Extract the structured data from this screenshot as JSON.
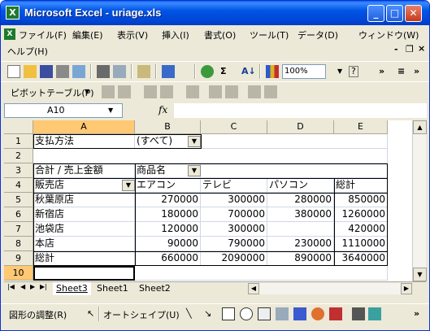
{
  "window": {
    "title": "Microsoft Excel - uriage.xls",
    "app_icon_label": "X"
  },
  "title_buttons": {
    "minimize": "_",
    "maximize": "□",
    "close": "✕"
  },
  "menu": [
    {
      "label": "ファイル(F)"
    },
    {
      "label": "編集(E)"
    },
    {
      "label": "表示(V)"
    },
    {
      "label": "挿入(I)"
    },
    {
      "label": "書式(O)"
    },
    {
      "label": "ツール(T)"
    },
    {
      "label": "データ(D)"
    },
    {
      "label": "ウィンドウ(W)"
    },
    {
      "label": "ヘルプ(H)"
    }
  ],
  "mdi_buttons": {
    "minimize": "-",
    "restore": "❐",
    "close": "×"
  },
  "toolbar": {
    "zoom": "100%",
    "more": "»",
    "pivot_label": "ピボットテーブル(P)",
    "help_icon": "?"
  },
  "formula_bar": {
    "name_box": "A10",
    "fx": "fx",
    "formula": ""
  },
  "columns": [
    "A",
    "B",
    "C",
    "D",
    "E"
  ],
  "rows": [
    "1",
    "2",
    "3",
    "4",
    "5",
    "6",
    "7",
    "8",
    "9",
    "10"
  ],
  "cells": {
    "r1": {
      "a": "支払方法",
      "b": "(すべて)"
    },
    "r3": {
      "a": "合計 / 売上金額",
      "b": "商品名"
    },
    "r4": {
      "a": "販売店",
      "b": "エアコン",
      "c": "テレビ",
      "d": "パソコン",
      "e": "総計"
    },
    "r5": {
      "a": "秋葉原店",
      "b": "270000",
      "c": "300000",
      "d": "280000",
      "e": "850000"
    },
    "r6": {
      "a": "新宿店",
      "b": "180000",
      "c": "700000",
      "d": "380000",
      "e": "1260000"
    },
    "r7": {
      "a": "池袋店",
      "b": "120000",
      "c": "300000",
      "d": "",
      "e": "420000"
    },
    "r8": {
      "a": "本店",
      "b": "90000",
      "c": "790000",
      "d": "230000",
      "e": "1110000"
    },
    "r9": {
      "a": "総計",
      "b": "660000",
      "c": "2090000",
      "d": "890000",
      "e": "3640000"
    }
  },
  "dropdown_arrow": "▼",
  "sheet_tabs": [
    "Sheet3",
    "Sheet1",
    "Sheet2"
  ],
  "active_sheet": "Sheet3",
  "draw_toolbar": {
    "draw_label": "図形の調整(R)",
    "autoshape_label": "オートシェイプ(U)"
  },
  "colors": {
    "selection": "#ffc873",
    "titlebar": "#0055e5",
    "chrome": "#ece9d8"
  }
}
